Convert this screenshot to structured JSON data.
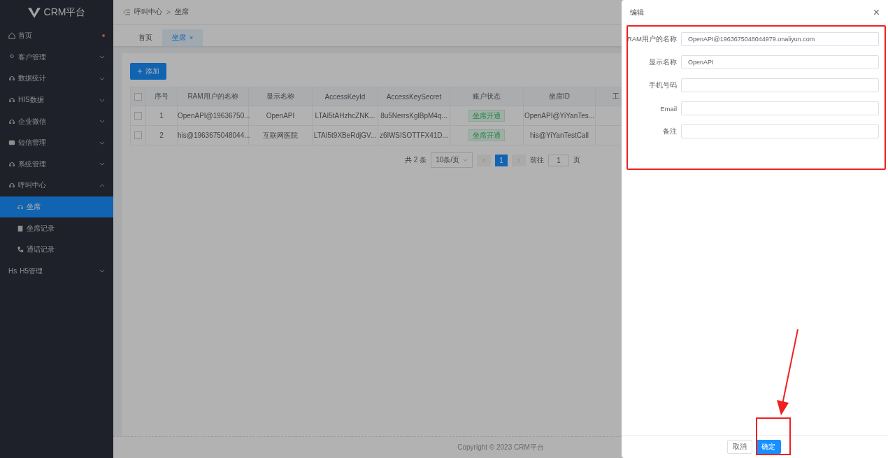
{
  "app": {
    "name": "CRM平台"
  },
  "sidebar": {
    "items": [
      {
        "label": "首页",
        "expanded": false,
        "badge_dot": true
      },
      {
        "label": "客户管理",
        "expanded": false
      },
      {
        "label": "数据统计",
        "expanded": false
      },
      {
        "label": "HIS数据",
        "expanded": false
      },
      {
        "label": "企业微信",
        "expanded": false
      },
      {
        "label": "短信管理",
        "expanded": false
      },
      {
        "label": "系统管理",
        "expanded": false
      },
      {
        "label": "呼叫中心",
        "expanded": true,
        "children": [
          {
            "label": "坐席",
            "selected": true
          },
          {
            "label": "坐席记录",
            "selected": false
          },
          {
            "label": "通话记录",
            "selected": false
          }
        ]
      },
      {
        "label": "H5管理",
        "icon_text": "Hs",
        "expanded": false
      }
    ]
  },
  "breadcrumb": [
    "呼叫中心",
    "坐席"
  ],
  "separator": ">",
  "tabs": [
    {
      "label": "首页",
      "selected": false,
      "closable": false
    },
    {
      "label": "坐席",
      "selected": true,
      "closable": true,
      "close": "×"
    }
  ],
  "add_button": "添加",
  "table": {
    "all_checked": false,
    "columns": [
      "序号",
      "RAM用户的名称",
      "显示名称",
      "AccessKeyId",
      "AccessKeySecret",
      "账户状态",
      "坐席ID",
      "工"
    ],
    "rows": [
      {
        "checked": false,
        "cells": [
          "1",
          "OpenAPI@19636750...",
          "OpenAPI",
          "LTAI5tAHzhcZNK...",
          "8u5NerrsKglBpM4q...",
          "坐席开通",
          "OpenAPI@YiYanTes..."
        ]
      },
      {
        "checked": false,
        "cells": [
          "2",
          "his@1963675048044...",
          "互联网医院",
          "LTAI5t9XBeRdjGV...",
          "z6lWSISOTTFX41D...",
          "坐席开通",
          "his@YiYanTestCall"
        ]
      }
    ]
  },
  "pagination": {
    "total": "共 2 条",
    "page_size": "10条/页",
    "pages": [
      {
        "label": "1",
        "selected": true
      }
    ],
    "goto_label": "前往",
    "goto_value": "1",
    "goto_suffix": "页"
  },
  "footer": "Copyright © 2023 CRM平台",
  "drawer": {
    "title": "编辑",
    "close": "×",
    "fields": [
      {
        "label": "RAM用户的名称",
        "value": "OpenAPI@1963675048044979.onaliyun.com"
      },
      {
        "label": "显示名称",
        "value": "OpenAPI"
      },
      {
        "label": "手机号码"
      },
      {
        "label": "Email"
      },
      {
        "label": "备注"
      }
    ],
    "buttons": [
      {
        "label": "取消",
        "kind": "default"
      },
      {
        "label": "确定",
        "kind": "primary"
      }
    ]
  }
}
